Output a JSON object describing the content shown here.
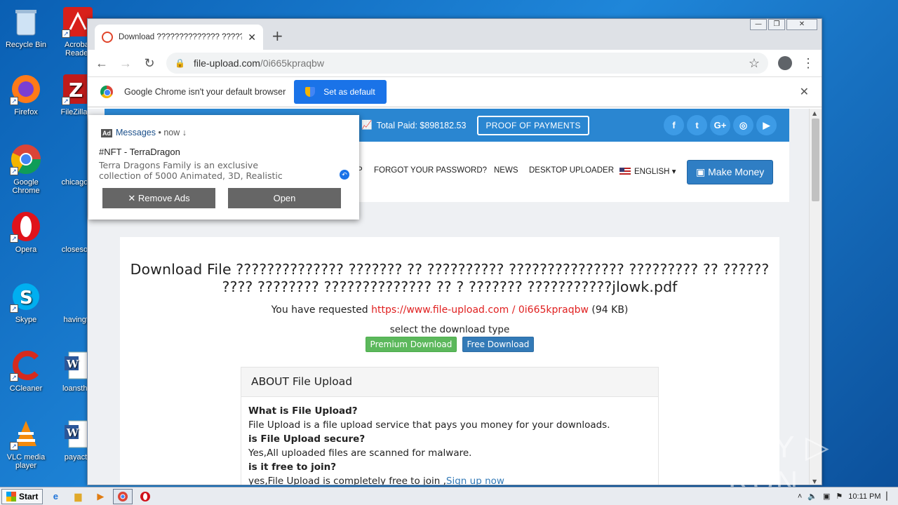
{
  "desktop": {
    "icons": [
      {
        "label": "Recycle Bin"
      },
      {
        "label": "Acrobat Reader"
      },
      {
        "label": "Firefox"
      },
      {
        "label": "FileZilla C"
      },
      {
        "label": "Google Chrome"
      },
      {
        "label": "chicagoto"
      },
      {
        "label": "Opera"
      },
      {
        "label": "closesom"
      },
      {
        "label": "Skype"
      },
      {
        "label": "havingfit"
      },
      {
        "label": "CCleaner"
      },
      {
        "label": "loansthin"
      },
      {
        "label": "VLC media player"
      },
      {
        "label": "payactu"
      }
    ]
  },
  "browser": {
    "tab_title": "Download ?????????????? ??????? ??",
    "url_host": "file-upload.com",
    "url_path": "/0i665kpraqbw",
    "infobar_text": "Google Chrome isn't your default browser",
    "set_default_label": "Set as default"
  },
  "site": {
    "total_paid": "Total Paid: $898182.53",
    "proof_label": "PROOF OF PAYMENTS",
    "socials": [
      "f",
      "t",
      "G+",
      "◎",
      "▶"
    ],
    "nav": {
      "partial": "P",
      "forgot": "FORGOT YOUR PASSWORD?",
      "news": "NEWS",
      "desktop_uploader": "DESKTOP UPLOADER",
      "language": "ENGLISH",
      "make_money": "Make Money"
    },
    "card": {
      "title": "Download File ?????????????? ??????? ?? ?????????? ??????????????? ????????? ?? ?????? ???? ???????? ?????????????? ?? ? ??????? ???????????jlowk.pdf",
      "requested_prefix": "You have requested",
      "requested_link": "https://www.file-upload.com / 0i665kpraqbw",
      "requested_size": "(94 KB)",
      "select_type": "select the download type",
      "premium_label": "Premium Download",
      "free_label": "Free Download"
    },
    "about": {
      "heading": "ABOUT File Upload",
      "q1": "What is File Upload?",
      "a1": "File Upload is a file upload service that pays you money for your downloads.",
      "q2": "is File Upload secure?",
      "a2": "Yes,All uploaded files are scanned for malware.",
      "q3": "is it free to join?",
      "a3_prefix": "yes,File Upload is completely free to join ,",
      "a3_link": "Sign up now"
    }
  },
  "ad_popup": {
    "badge": "Ad",
    "source": "Messages",
    "time": "• now ↓",
    "title": "#NFT - TerraDragon",
    "body": "Terra Dragons Family is an exclusive collection of 5000 Animated, 3D, Realistic",
    "remove_label": "✕ Remove Ads",
    "open_label": "Open"
  },
  "watermark": "ANY ▷ RUN",
  "taskbar": {
    "start_label": "Start",
    "clock": "10:11 PM"
  }
}
